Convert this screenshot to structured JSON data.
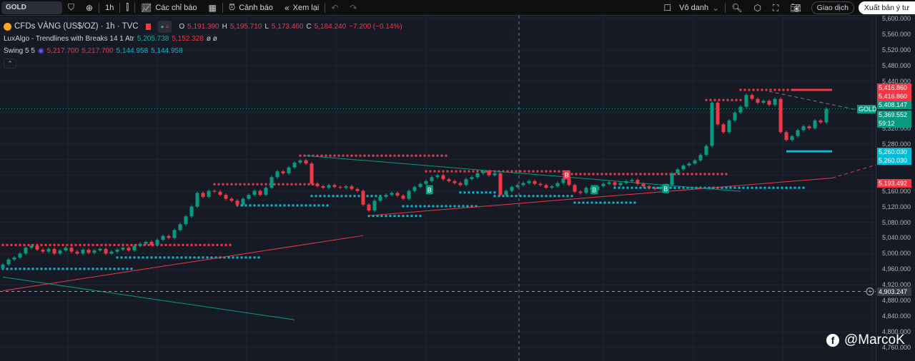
{
  "toolbar": {
    "symbol": "GOLD",
    "interval": "1h",
    "indicators": "Các chỉ báo",
    "alerts": "Cảnh báo",
    "replay": "Xem lại",
    "layout_name": "Vô danh",
    "trade": "Giao dịch",
    "publish": "Xuất bản ý tư"
  },
  "legend": {
    "title": "CFDs VÀNG (US$/OZ) · 1h · TVC",
    "o_label": "O",
    "o": "5,191.390",
    "h_label": "H",
    "h": "5,195.710",
    "l_label": "L",
    "l": "5,173.460",
    "c_label": "C",
    "c": "5,184.240",
    "change": "−7.200 (−0.14%)",
    "ind1_name": "LuxAlgo - Trendlines with Breaks 14 1 Atr",
    "ind1_v1": "5,205.738",
    "ind1_v2": "5,152.328",
    "ind1_v3": "ø ø",
    "ind2_name": "Swing 5 5",
    "ind2_v1": "5,217.700",
    "ind2_v2": "5,217.700",
    "ind2_v3": "5,144.958",
    "ind2_v4": "5,144.958"
  },
  "price_axis": {
    "ticks": [
      "5,600.000",
      "5,560.000",
      "5,520.000",
      "5,480.000",
      "5,440.000",
      "5,320.000",
      "5,280.000",
      "5,160.000",
      "5,120.000",
      "5,080.000",
      "5,040.000",
      "5,000.000",
      "4,960.000",
      "4,920.000",
      "4,880.000",
      "4,840.000",
      "4,800.000",
      "4,760.000"
    ],
    "tick_values": [
      5600,
      5560,
      5520,
      5480,
      5440,
      5320,
      5280,
      5160,
      5120,
      5080,
      5040,
      5000,
      4960,
      4920,
      4880,
      4840,
      4800,
      4760
    ],
    "tags": [
      {
        "text": "5,416.860",
        "price": 5423,
        "color": "#f23645"
      },
      {
        "text": "5,416.860",
        "price": 5401,
        "color": "#f23645"
      },
      {
        "text": "5,408.147",
        "price": 5379,
        "color": "#089981"
      },
      {
        "text": "5,369.552",
        "price": 5354,
        "color": "#089981"
      },
      {
        "text": "59:12",
        "price": 5333,
        "color": "#089981"
      },
      {
        "text": "5,260.030",
        "price": 5259,
        "color": "#00bcd4"
      },
      {
        "text": "5,260.030",
        "price": 5237,
        "color": "#00bcd4"
      },
      {
        "text": "5,193.492",
        "price": 5179,
        "color": "#f23645"
      }
    ],
    "symbol_tag": "GOLD",
    "crosshair_price": "4,903.247",
    "crosshair_value": 4903.247
  },
  "watermark": "@MarcoK",
  "colors": {
    "up": "#089981",
    "down": "#f23645",
    "resistance": "#f23645",
    "support": "#00bcd4",
    "bg": "#161a25"
  },
  "chart_data": {
    "type": "candlestick",
    "symbol": "GOLD",
    "interval": "1h",
    "ylim": [
      4760,
      5600
    ],
    "closes": [
      4972,
      4985,
      4990,
      5000,
      5015,
      5020,
      5010,
      5005,
      5012,
      5000,
      5008,
      5015,
      5005,
      5000,
      5010,
      5002,
      5008,
      5012,
      5000,
      5005,
      5010,
      5015,
      5008,
      5020,
      5025,
      5030,
      5022,
      5035,
      5045,
      5040,
      5060,
      5075,
      5095,
      5120,
      5155,
      5145,
      5160,
      5158,
      5150,
      5140,
      5135,
      5125,
      5140,
      5150,
      5160,
      5150,
      5168,
      5195,
      5210,
      5205,
      5220,
      5232,
      5238,
      5230,
      5178,
      5172,
      5168,
      5175,
      5170,
      5168,
      5172,
      5165,
      5160,
      5125,
      5110,
      5135,
      5145,
      5150,
      5155,
      5148,
      5140,
      5160,
      5170,
      5178,
      5185,
      5195,
      5200,
      5190,
      5185,
      5180,
      5175,
      5190,
      5195,
      5205,
      5210,
      5200,
      5205,
      5150,
      5160,
      5170,
      5175,
      5180,
      5185,
      5178,
      5175,
      5168,
      5172,
      5180,
      5192,
      5175,
      5158,
      5155,
      5168,
      5162,
      5172,
      5178,
      5182,
      5175,
      5180,
      5185,
      5188,
      5178,
      5172,
      5168,
      5165,
      5170,
      5175,
      5205,
      5215,
      5225,
      5230,
      5238,
      5252,
      5275,
      5385,
      5330,
      5310,
      5340,
      5360,
      5375,
      5405,
      5395,
      5385,
      5390,
      5380,
      5395,
      5310,
      5290,
      5300,
      5315,
      5325,
      5320,
      5340,
      5335,
      5369.552
    ],
    "resistance_levels": [
      {
        "price": 5022,
        "from": 0,
        "to": 40
      },
      {
        "price": 5177,
        "from": 37,
        "to": 55
      },
      {
        "price": 5250,
        "from": 52,
        "to": 78
      },
      {
        "price": 5210,
        "from": 74,
        "to": 98
      },
      {
        "price": 5203,
        "from": 98,
        "to": 127
      },
      {
        "price": 5392,
        "from": 123,
        "to": 129
      },
      {
        "price": 5418,
        "from": 129,
        "to": 145
      }
    ],
    "resistance_thick": {
      "price": 5418,
      "from": 138,
      "to": 145
    },
    "support_levels": [
      {
        "price": 4961,
        "from": 0,
        "to": 23
      },
      {
        "price": 4990,
        "from": 20,
        "to": 45
      },
      {
        "price": 5123,
        "from": 41,
        "to": 57
      },
      {
        "price": 5147,
        "from": 54,
        "to": 66
      },
      {
        "price": 5096,
        "from": 64,
        "to": 73
      },
      {
        "price": 5121,
        "from": 70,
        "to": 83
      },
      {
        "price": 5156,
        "from": 80,
        "to": 86
      },
      {
        "price": 5147,
        "from": 86,
        "to": 100
      },
      {
        "price": 5130,
        "from": 100,
        "to": 111
      },
      {
        "price": 5168,
        "from": 107,
        "to": 140
      }
    ],
    "support_thick": {
      "price": 5261,
      "from": 137,
      "to": 145
    },
    "trendlines": [
      {
        "color": "#f23645",
        "dashed": false,
        "from": [
          0,
          4905
        ],
        "to": [
          63,
          5046
        ]
      },
      {
        "color": "#f23645",
        "dashed": false,
        "from": [
          64,
          5097
        ],
        "to": [
          145,
          5193
        ]
      },
      {
        "color": "#f23645",
        "dashed": true,
        "from": [
          145,
          5193
        ],
        "to": [
          153,
          5228
        ]
      },
      {
        "color": "#089981",
        "dashed": false,
        "from": [
          0,
          4940
        ],
        "to": [
          51,
          4831
        ]
      },
      {
        "color": "#089981",
        "dashed": false,
        "from": [
          53,
          5250
        ],
        "to": [
          129,
          5159
        ]
      },
      {
        "color": "#787b86",
        "dashed": true,
        "from": [
          134,
          5414
        ],
        "to": [
          149,
          5368
        ]
      }
    ],
    "break_labels": [
      {
        "text": "B",
        "bar": 74.6,
        "price": 5162,
        "type": "bull"
      },
      {
        "text": "B",
        "bar": 103.4,
        "price": 5162,
        "type": "bull"
      },
      {
        "text": "B",
        "bar": 115.9,
        "price": 5165,
        "type": "bull"
      },
      {
        "text": "B",
        "bar": 98.6,
        "price": 5200,
        "type": "bear"
      }
    ]
  }
}
